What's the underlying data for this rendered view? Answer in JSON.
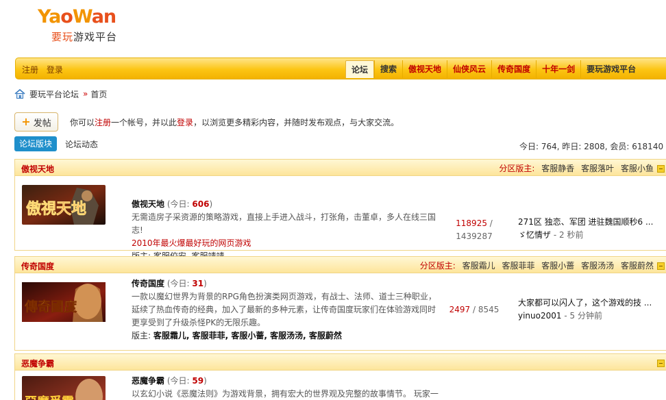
{
  "logo": {
    "brand_a": "Ya",
    "brand_b": "o",
    "brand_c": "W",
    "brand_d": "an",
    "tagline_a": "要玩",
    "tagline_b": "游戏平台"
  },
  "nav": {
    "register": "注册",
    "login": "登录",
    "items": [
      {
        "label": "论坛"
      },
      {
        "label": "搜索"
      },
      {
        "label": "傲视天地"
      },
      {
        "label": "仙侠风云"
      },
      {
        "label": "传奇国度"
      },
      {
        "label": "十年一剑"
      },
      {
        "label": "要玩游戏平台"
      }
    ]
  },
  "breadcrumb": {
    "forum": "要玩平台论坛",
    "sep": "»",
    "current": "首页"
  },
  "post_button": {
    "label": "发帖"
  },
  "welcome": {
    "t1": "你可以",
    "register": "注册",
    "t2": "一个帐号，并以此",
    "login": "登录",
    "t3": "，以浏览更多精彩内容，并随时发布观点，与大家交流。"
  },
  "tabs": {
    "forums": "论坛版块",
    "activity": "论坛动态"
  },
  "stats": "今日: 764, 昨日: 2808, 会员: 618140",
  "sections": [
    {
      "title": "傲视天地",
      "mods_label": "分区版主:",
      "mods": [
        "客服静香",
        "客服落叶",
        "客服小鱼"
      ],
      "forum": {
        "name": "傲视天地",
        "today_label": "(今日:",
        "today_count": "606",
        "today_close": ")",
        "desc": "无需造房子采资源的策略游戏，直接上手进入战斗，打张角，击董卓，多人在线三国志!",
        "hot": "2010年最火爆最好玩的网页游戏",
        "mods_line": "版主: 客服佼安, 客服靖靖",
        "threads": "118925",
        "posts": "1439287",
        "last_title": "271区 独恋、军团 进驻魏国顺秒6 ...",
        "last_author": "ゞ忆情ザ",
        "last_ago": "- 2 秒前"
      }
    },
    {
      "title": "传奇国度",
      "mods_label": "分区版主:",
      "mods": [
        "客服霜儿",
        "客服菲菲",
        "客服小蔷",
        "客服汤汤",
        "客服蔚然"
      ],
      "forum": {
        "name": "传奇国度",
        "today_label": "(今日:",
        "today_count": "31",
        "today_close": ")",
        "desc": "一款以魔幻世界为背景的RPG角色扮演类网页游戏，有战士、法师、道士三种职业，延续了热血传奇的经典，加入了最新的多种元素，让传奇国度玩家们在体验游戏同时更享受到了升级杀怪PK的无限乐趣。",
        "mods_prefix": "版主:",
        "mods_bold": "客服霜儿, 客服菲菲, 客服小蔷, 客服汤汤, 客服蔚然",
        "threads": "2497",
        "posts": "8545",
        "last_title": "大家都可以闪人了，这个游戏的技 ...",
        "last_author": "yinuo2001",
        "last_ago": "- 5 分钟前"
      }
    },
    {
      "title": "恶魔争霸",
      "forum": {
        "name": "恶魔争霸",
        "today_label": "(今日:",
        "today_count": "59",
        "today_close": ")",
        "desc": "以玄幻小说《恶魔法则》为游戏背景，拥有宏大的世界观及完整的故事情节。 玩家一"
      }
    }
  ],
  "colors": {
    "accent": "#c00000",
    "nav_bg": "#fcc514",
    "tab_blue": "#1f8fcb"
  }
}
